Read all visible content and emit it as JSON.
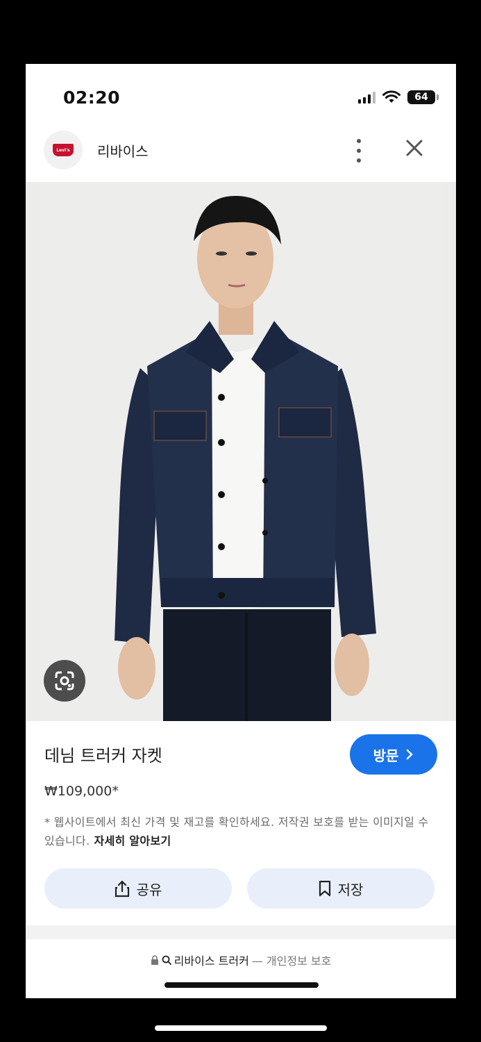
{
  "status_bar": {
    "time": "02:20",
    "battery": "64"
  },
  "header": {
    "site_name": "리바이스",
    "logo_text": "Levi's"
  },
  "product": {
    "title": "데님 트러커 자켓",
    "price": "₩109,000*",
    "visit_label": "방문",
    "disclaimer": "* 웹사이트에서 최신 가격 및 재고를 확인하세요. 저작권 보호를 받는 이미지일 수 있습니다.",
    "learn_more": "자세히 알아보기"
  },
  "actions": {
    "share_label": "공유",
    "save_label": "저장"
  },
  "address_bar": {
    "query": "리바이스 트러커",
    "suffix": "— 개인정보 보호"
  },
  "colors": {
    "accent": "#1a73e8",
    "action_bg": "#e8effa",
    "brand_red": "#c41230"
  },
  "icons": [
    "more-vert-icon",
    "close-icon",
    "google-lens-icon",
    "share-icon",
    "bookmark-icon",
    "lock-icon",
    "search-icon",
    "chevron-right-icon"
  ]
}
